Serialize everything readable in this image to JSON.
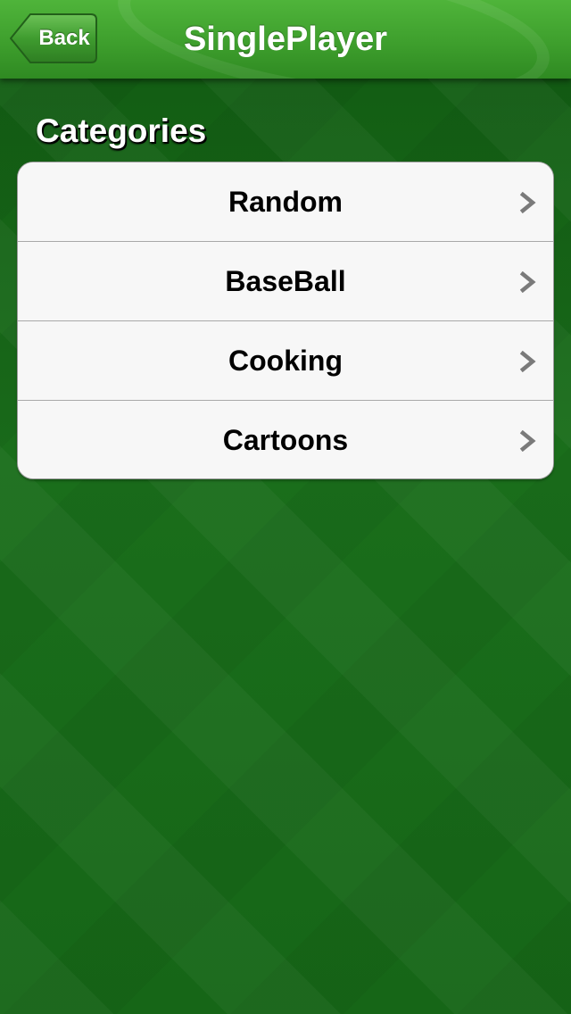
{
  "navbar": {
    "title": "SinglePlayer",
    "back_label": "Back"
  },
  "section": {
    "header": "Categories"
  },
  "categories": [
    {
      "label": "Random",
      "icon": "chevron-right-icon"
    },
    {
      "label": "BaseBall",
      "icon": "chevron-right-icon"
    },
    {
      "label": "Cooking",
      "icon": "chevron-right-icon"
    },
    {
      "label": "Cartoons",
      "icon": "chevron-right-icon"
    }
  ],
  "colors": {
    "navbar": "#3e9f2d",
    "background": "#156a16",
    "cell": "#f7f7f7",
    "chevron": "#7a7a7a"
  }
}
